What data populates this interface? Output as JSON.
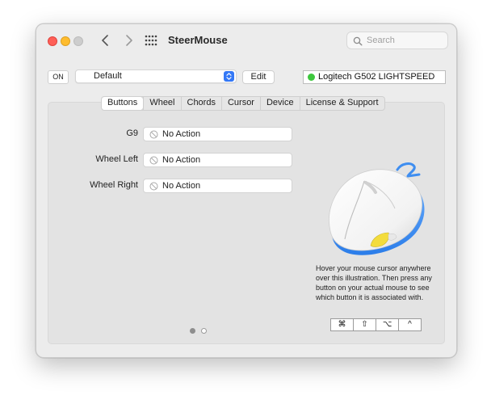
{
  "app": {
    "title": "SteerMouse"
  },
  "search": {
    "placeholder": "Search"
  },
  "toolbar": {
    "on_label": "ON",
    "profile": "Default",
    "edit_label": "Edit",
    "device_name": "Logitech G502 LIGHTSPEED",
    "device_status_color": "#3dc73d"
  },
  "tabs": [
    {
      "label": "Buttons",
      "active": true
    },
    {
      "label": "Wheel"
    },
    {
      "label": "Chords"
    },
    {
      "label": "Cursor"
    },
    {
      "label": "Device"
    },
    {
      "label": "License & Support"
    }
  ],
  "buttons": [
    {
      "label": "G9",
      "action": "No Action"
    },
    {
      "label": "Wheel Left",
      "action": "No Action"
    },
    {
      "label": "Wheel Right",
      "action": "No Action"
    }
  ],
  "hint": "Hover your mouse cursor anywhere over this illustration. Then press any button on your actual mouse to see which button it is associated with.",
  "pager": {
    "pages": 2,
    "current": 1
  },
  "modifiers": [
    "⌘",
    "⇧",
    "⌥",
    "^"
  ],
  "colors": {
    "accent": "#3478f6",
    "close": "#fe5f57",
    "minimize": "#febc2e",
    "mouse_highlight": "#f3dc3c",
    "mouse_glow": "#3f8ef0"
  }
}
